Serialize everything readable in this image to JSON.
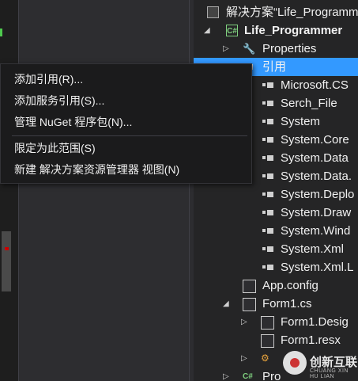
{
  "context_menu": {
    "items": [
      {
        "label": "添加引用(R)..."
      },
      {
        "label": "添加服务引用(S)..."
      },
      {
        "label": "管理 NuGet 程序包(N)..."
      },
      {
        "label": "限定为此范围(S)"
      },
      {
        "label": "新建 解决方案资源管理器 视图(N)"
      }
    ]
  },
  "solution_explorer": {
    "nodes": [
      {
        "label": "解决方案“Life_Programmer”",
        "icon": "solution-icon"
      },
      {
        "label": "Life_Programmer",
        "icon": "csharp-project-icon",
        "expanded": true
      },
      {
        "label": "Properties",
        "icon": "wrench-icon"
      },
      {
        "label": "引用",
        "icon": "references-icon",
        "selected": true
      },
      {
        "label": "Microsoft.CS",
        "icon": "reference-icon"
      },
      {
        "label": "Serch_File",
        "icon": "reference-icon"
      },
      {
        "label": "System",
        "icon": "reference-icon"
      },
      {
        "label": "System.Core",
        "icon": "reference-icon"
      },
      {
        "label": "System.Data",
        "icon": "reference-icon"
      },
      {
        "label": "System.Data.",
        "icon": "reference-icon"
      },
      {
        "label": "System.Deplo",
        "icon": "reference-icon"
      },
      {
        "label": "System.Draw",
        "icon": "reference-icon"
      },
      {
        "label": "System.Wind",
        "icon": "reference-icon"
      },
      {
        "label": "System.Xml",
        "icon": "reference-icon"
      },
      {
        "label": "System.Xml.L",
        "icon": "reference-icon"
      },
      {
        "label": "App.config",
        "icon": "config-file-icon"
      },
      {
        "label": "Form1.cs",
        "icon": "form-icon"
      },
      {
        "label": "Form1.Desig",
        "icon": "cs-file-icon"
      },
      {
        "label": "Form1.resx",
        "icon": "resx-file-icon"
      },
      {
        "label": "",
        "icon": "program-icon"
      },
      {
        "label": "Pro",
        "icon": "csharp-file-icon"
      }
    ]
  },
  "watermark": {
    "title": "创新互联",
    "subtitle": "CHUANG XIN HU LIAN"
  },
  "colors": {
    "selection": "#3399ff",
    "menu_bg": "#1b1b1c",
    "explorer_bg": "#252526"
  }
}
